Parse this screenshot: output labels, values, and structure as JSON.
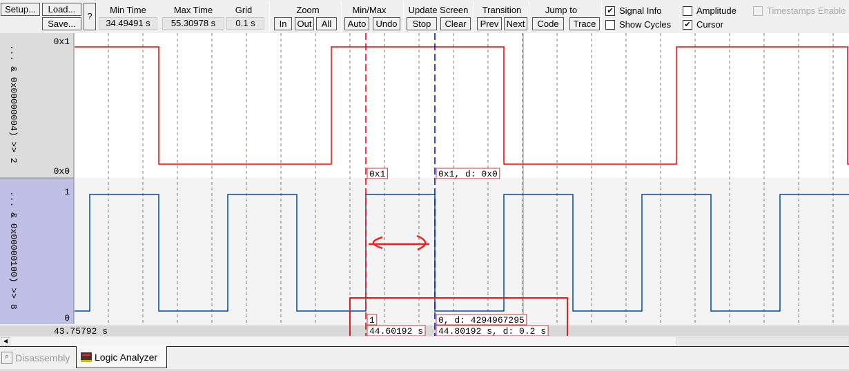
{
  "toolbar": {
    "setup": "Setup...",
    "load": "Load...",
    "save": "Save...",
    "help": "?",
    "min_time_label": "Min Time",
    "min_time": "34.49491 s",
    "max_time_label": "Max Time",
    "max_time": "55.30978 s",
    "grid_label": "Grid",
    "grid": "0.1 s",
    "zoom_label": "Zoom",
    "zoom_in": "In",
    "zoom_out": "Out",
    "zoom_all": "All",
    "minmax_label": "Min/Max",
    "auto": "Auto",
    "undo": "Undo",
    "update_label": "Update Screen",
    "stop": "Stop",
    "clear": "Clear",
    "transition_label": "Transition",
    "prev": "Prev",
    "next": "Next",
    "jump_label": "Jump to",
    "code": "Code",
    "trace": "Trace",
    "checkboxes": [
      {
        "label": "Signal Info",
        "checked": true,
        "enabled": true
      },
      {
        "label": "Show Cycles",
        "checked": false,
        "enabled": true
      },
      {
        "label": "Amplitude",
        "checked": false,
        "enabled": true
      },
      {
        "label": "Cursor",
        "checked": true,
        "enabled": true
      },
      {
        "label": "Timestamps Enable",
        "checked": false,
        "enabled": false
      }
    ]
  },
  "signals": [
    {
      "name": "... & 0x00000004) >> 2",
      "max": "0x1",
      "min": "0x0",
      "color": "#ff0000",
      "transitions": [
        [
          43.75792,
          1
        ],
        [
          44.00192,
          0
        ],
        [
          44.50192,
          1
        ],
        [
          45.00192,
          0
        ],
        [
          45.50192,
          1
        ],
        [
          45.99792,
          0
        ]
      ],
      "cursor_value": "0x1",
      "cursor2_value": "0x1,  d: 0x0"
    },
    {
      "name": "... & 0x00000100) >> 8",
      "max": "1",
      "min": "0",
      "color": "#004c99",
      "transitions": [
        [
          43.75792,
          0
        ],
        [
          43.80192,
          1
        ],
        [
          44.00192,
          0
        ],
        [
          44.20192,
          1
        ],
        [
          44.40192,
          0
        ],
        [
          44.60192,
          1
        ],
        [
          44.80192,
          0
        ],
        [
          45.00192,
          1
        ],
        [
          45.20192,
          0
        ],
        [
          45.40192,
          1
        ],
        [
          45.60192,
          0
        ],
        [
          45.80192,
          1
        ]
      ],
      "cursor_value": "1",
      "cursor2_value": "0,  d: 4294967295"
    }
  ],
  "time": {
    "left": "43.75792 s",
    "cursor1": "44.60192 s",
    "cursor2": "44.80192 s,  d: 0.2 s",
    "start": 43.75792,
    "end": 46.00192,
    "grid": 0.1,
    "cursor1_t": 44.60192,
    "cursor2_t": 44.80192,
    "marker_t": 45.05792
  },
  "tabs": [
    {
      "label": "Disassembly",
      "active": false
    },
    {
      "label": "Logic Analyzer",
      "active": true
    }
  ]
}
